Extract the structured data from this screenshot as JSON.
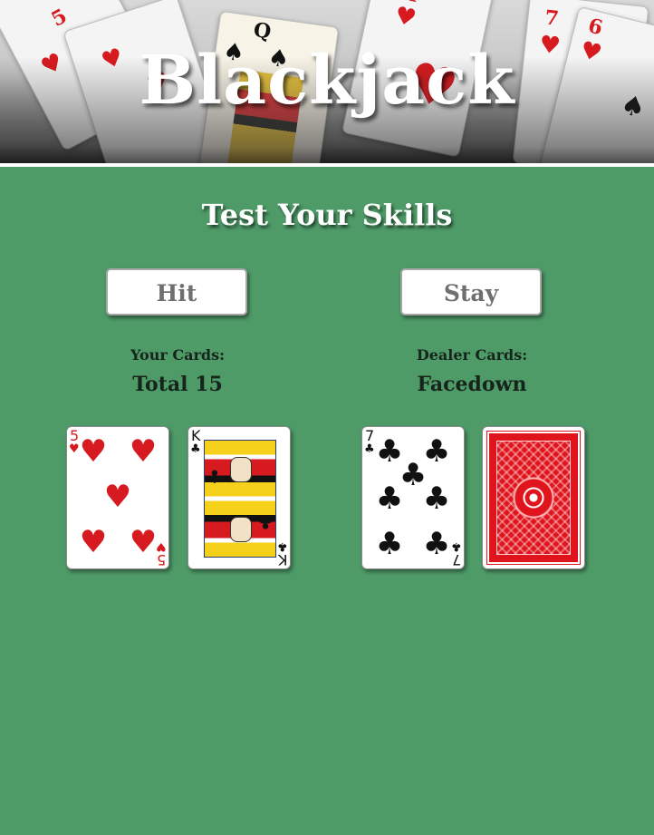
{
  "header": {
    "title": "Blackjack",
    "background_cards": [
      {
        "rank": "5",
        "suit": "♥",
        "color": "red"
      },
      {
        "rank": "Q",
        "suit": "♠",
        "color": "black"
      },
      {
        "rank": "A",
        "suit": "♥",
        "color": "red"
      },
      {
        "rank": "7",
        "suit": "♥",
        "color": "red"
      },
      {
        "rank": "6",
        "suit": "♥",
        "color": "red"
      }
    ]
  },
  "main": {
    "subtitle": "Test Your Skills",
    "buttons": {
      "hit_label": "Hit",
      "stay_label": "Stay"
    },
    "player": {
      "label": "Your Cards:",
      "status": "Total 15",
      "cards": [
        {
          "rank": "5",
          "suit": "♥",
          "color": "#d61a1f",
          "face_up": true
        },
        {
          "rank": "K",
          "suit": "♣",
          "color": "#111111",
          "face_up": true
        }
      ]
    },
    "dealer": {
      "label": "Dealer Cards:",
      "status": "Facedown",
      "cards": [
        {
          "rank": "7",
          "suit": "♣",
          "color": "#111111",
          "face_up": true
        },
        {
          "rank": "",
          "suit": "",
          "color": "#e0141c",
          "face_up": false
        }
      ]
    }
  },
  "colors": {
    "table_green": "#4e9b68",
    "card_red": "#d61a1f",
    "card_back_red": "#e0141c",
    "button_text": "#6f6f6f",
    "label_text": "#17241c"
  }
}
